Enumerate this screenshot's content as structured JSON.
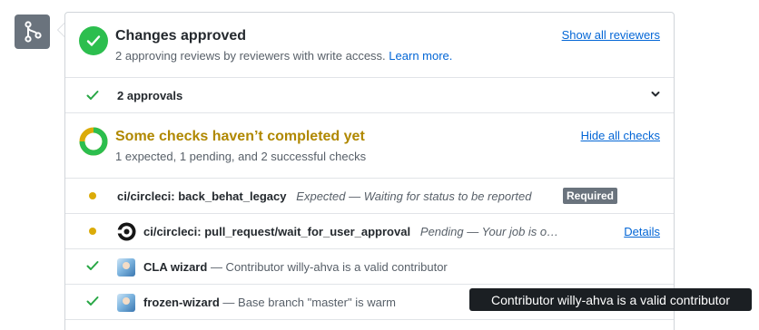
{
  "merge_box": {
    "icon": "git-merge-icon"
  },
  "reviews": {
    "title": "Changes approved",
    "subtitle": "2 approving reviews by reviewers with write access.",
    "learn_more": "Learn more.",
    "action": "Show all reviewers",
    "approvals_label": "2 approvals"
  },
  "checks": {
    "title": "Some checks haven’t completed yet",
    "subtitle": "1 expected, 1 pending, and 2 successful checks",
    "action": "Hide all checks",
    "items": [
      {
        "status": "pending",
        "context": "ci/circleci: back_behat_legacy",
        "description": "Expected — Waiting for status to be reported",
        "badge": "Required"
      },
      {
        "status": "pending",
        "context": "ci/circleci: pull_request/wait_for_user_approval",
        "description": "Pending — Your job is o…",
        "details": "Details"
      },
      {
        "status": "success",
        "context": "CLA wizard",
        "description": "— Contributor willy-ahva is a valid contributor"
      },
      {
        "status": "success",
        "context": "frozen-wizard",
        "description": "— Base branch \"master\" is warm"
      }
    ]
  },
  "tooltip": {
    "text": "Contributor willy-ahva is a valid contributor"
  },
  "colors": {
    "success": "#2cbe4e",
    "pending": "#dbab09",
    "link": "#0366d6",
    "pending_title": "#b08800"
  }
}
